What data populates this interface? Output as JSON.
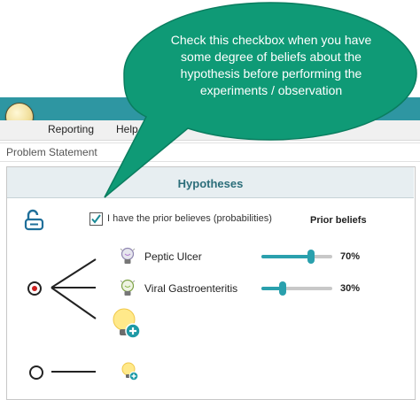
{
  "menu": {
    "reporting": "Reporting",
    "help": "Help"
  },
  "problem_statement": {
    "label": "Problem Statement"
  },
  "panel": {
    "title": "Hypotheses",
    "checkbox_label": "I have the prior believes (probabilities)",
    "checkbox_checked": true,
    "prior_header": "Prior beliefs"
  },
  "hypotheses": [
    {
      "label": "Peptic Ulcer",
      "prior_percent": "70%",
      "slider_value": 0.7
    },
    {
      "label": "Viral Gastroenteritis",
      "prior_percent": "30%",
      "slider_value": 0.3
    }
  ],
  "callout": {
    "text": "Check this checkbox when you have some degree of beliefs about the hypothesis before performing the experiments / observation"
  },
  "colors": {
    "accent": "#2aa0ad",
    "callout": "#0f9a76",
    "titlebar": "#2e96a2"
  },
  "icons": [
    "app-lightbulb-icon",
    "lock-open-icon",
    "checkbox-icon",
    "lightbulb-dim-icon",
    "lightbulb-green-icon",
    "add-hypothesis-icon",
    "target-icon",
    "node-icon"
  ]
}
